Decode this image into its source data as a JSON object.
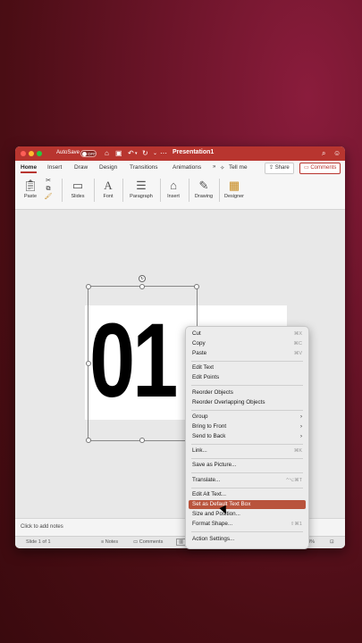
{
  "window": {
    "title": "Presentation1",
    "autosave_label": "AutoSave",
    "autosave_state": "OFF"
  },
  "ribbon": {
    "tabs": [
      "Home",
      "Insert",
      "Draw",
      "Design",
      "Transitions",
      "Animations",
      "Tell me"
    ],
    "share_label": "Share",
    "comments_label": "Comments",
    "tools": {
      "paste": "Paste",
      "slides": "Slides",
      "font": "Font",
      "paragraph": "Paragraph",
      "insert": "Insert",
      "drawing": "Drawing",
      "designer": "Designer"
    }
  },
  "slide": {
    "text": "01"
  },
  "notes": {
    "placeholder": "Click to add notes"
  },
  "status": {
    "slide_info": "Slide 1 of 1",
    "notes_label": "Notes",
    "comments_label": "Comments",
    "zoom": "48%"
  },
  "context_menu": {
    "items": [
      {
        "label": "Cut",
        "shortcut": "⌘X"
      },
      {
        "label": "Copy",
        "shortcut": "⌘C"
      },
      {
        "label": "Paste",
        "shortcut": "⌘V"
      },
      {
        "label": "Edit Text",
        "shortcut": ""
      },
      {
        "label": "Edit Points",
        "shortcut": ""
      },
      {
        "label": "Reorder Objects",
        "shortcut": ""
      },
      {
        "label": "Reorder Overlapping Objects",
        "shortcut": ""
      },
      {
        "label": "Group",
        "shortcut": "›"
      },
      {
        "label": "Bring to Front",
        "shortcut": "›"
      },
      {
        "label": "Send to Back",
        "shortcut": "›"
      },
      {
        "label": "Link...",
        "shortcut": "⌘K"
      },
      {
        "label": "Save as Picture...",
        "shortcut": ""
      },
      {
        "label": "Translate...",
        "shortcut": "^⌥⌘T"
      },
      {
        "label": "Edit Alt Text...",
        "shortcut": ""
      },
      {
        "label": "Set as Default Text Box",
        "shortcut": ""
      },
      {
        "label": "Size and Position...",
        "shortcut": ""
      },
      {
        "label": "Format Shape...",
        "shortcut": "⇧⌘1"
      },
      {
        "label": "Action Settings...",
        "shortcut": ""
      }
    ]
  }
}
